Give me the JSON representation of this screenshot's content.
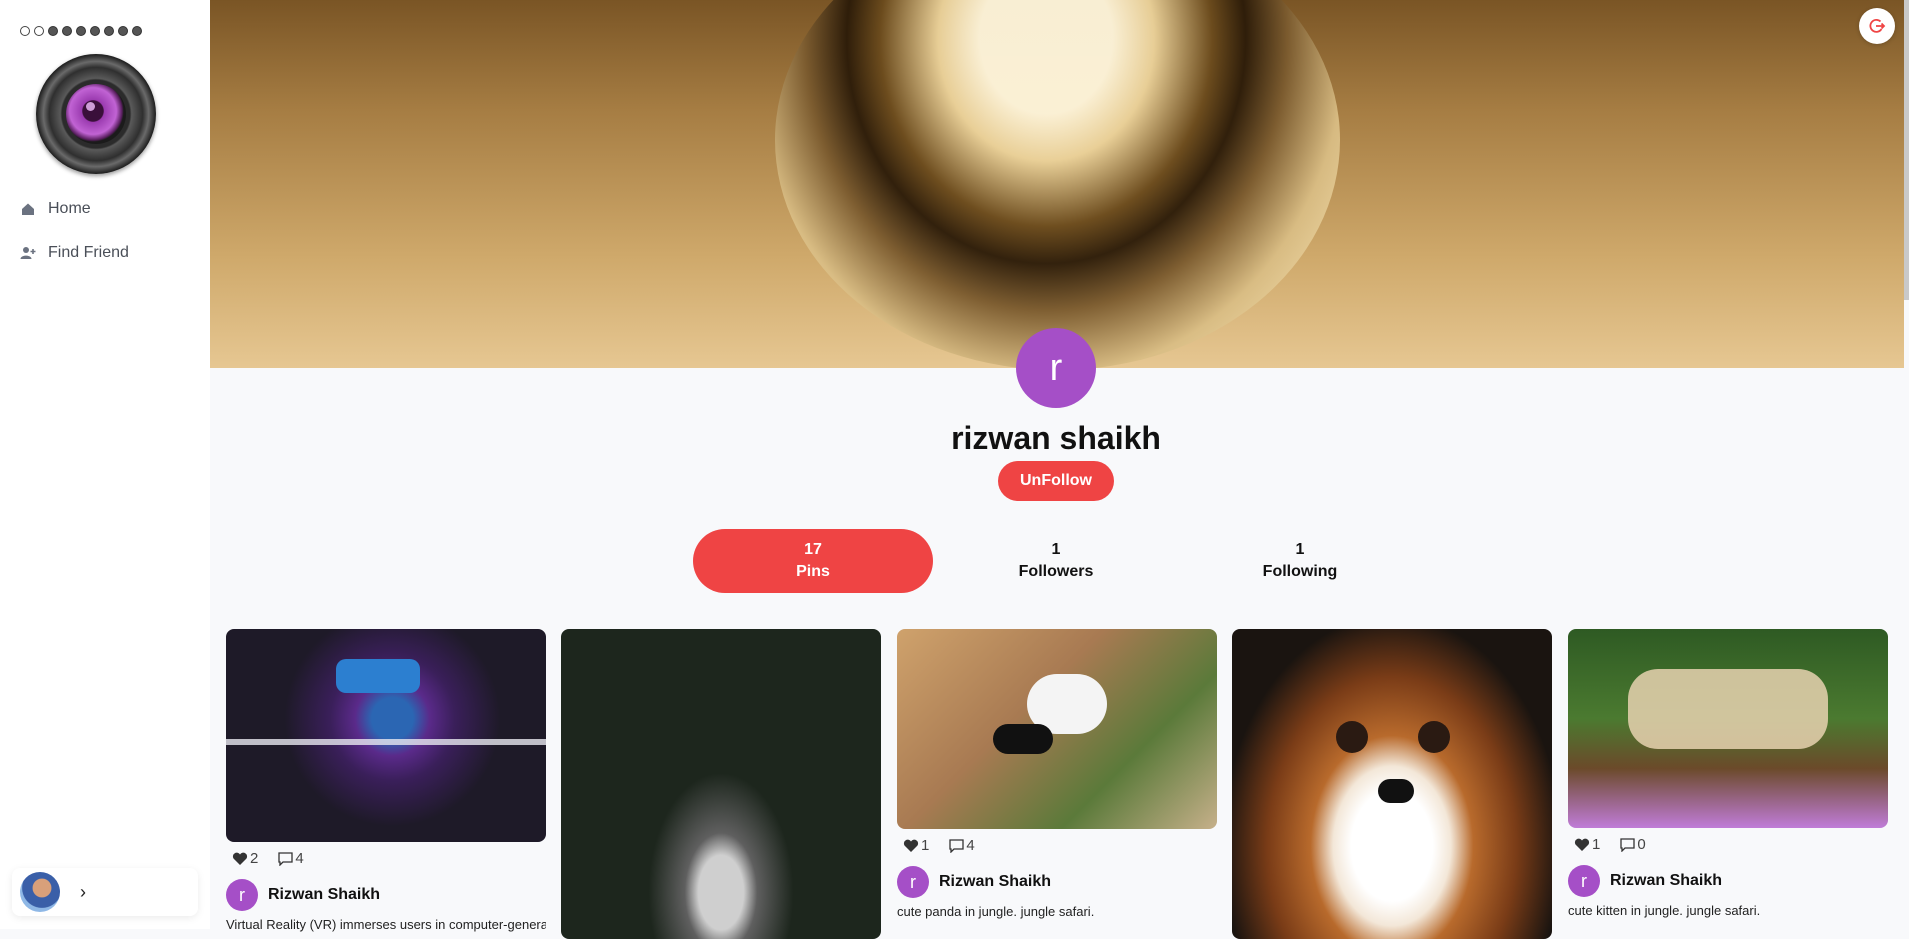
{
  "sidebar": {
    "nav": [
      {
        "label": "Home",
        "icon": "home-icon"
      },
      {
        "label": "Find Friend",
        "icon": "add-user-icon"
      }
    ]
  },
  "profile": {
    "avatar_letter": "r",
    "name": "rizwan shaikh",
    "follow_button": "UnFollow"
  },
  "stats": [
    {
      "value": "17",
      "label": "Pins",
      "active": true
    },
    {
      "value": "1",
      "label": "Followers",
      "active": false
    },
    {
      "value": "1",
      "label": "Following",
      "active": false
    }
  ],
  "pins": [
    {
      "likes": "2",
      "comments": "4",
      "author_letter": "r",
      "author": "Rizwan Shaikh",
      "description": "Virtual Reality (VR) immerses users in computer-generated"
    },
    {
      "likes": "",
      "comments": "",
      "author_letter": "",
      "author": "",
      "description": ""
    },
    {
      "likes": "1",
      "comments": "4",
      "author_letter": "r",
      "author": "Rizwan Shaikh",
      "description": "cute panda in jungle. jungle safari."
    },
    {
      "likes": "",
      "comments": "",
      "author_letter": "",
      "author": "",
      "description": ""
    },
    {
      "likes": "1",
      "comments": "0",
      "author_letter": "r",
      "author": "Rizwan Shaikh",
      "description": "cute kitten in jungle. jungle safari."
    }
  ],
  "colors": {
    "accent": "#ef4444",
    "avatar": "#a54fc7"
  }
}
